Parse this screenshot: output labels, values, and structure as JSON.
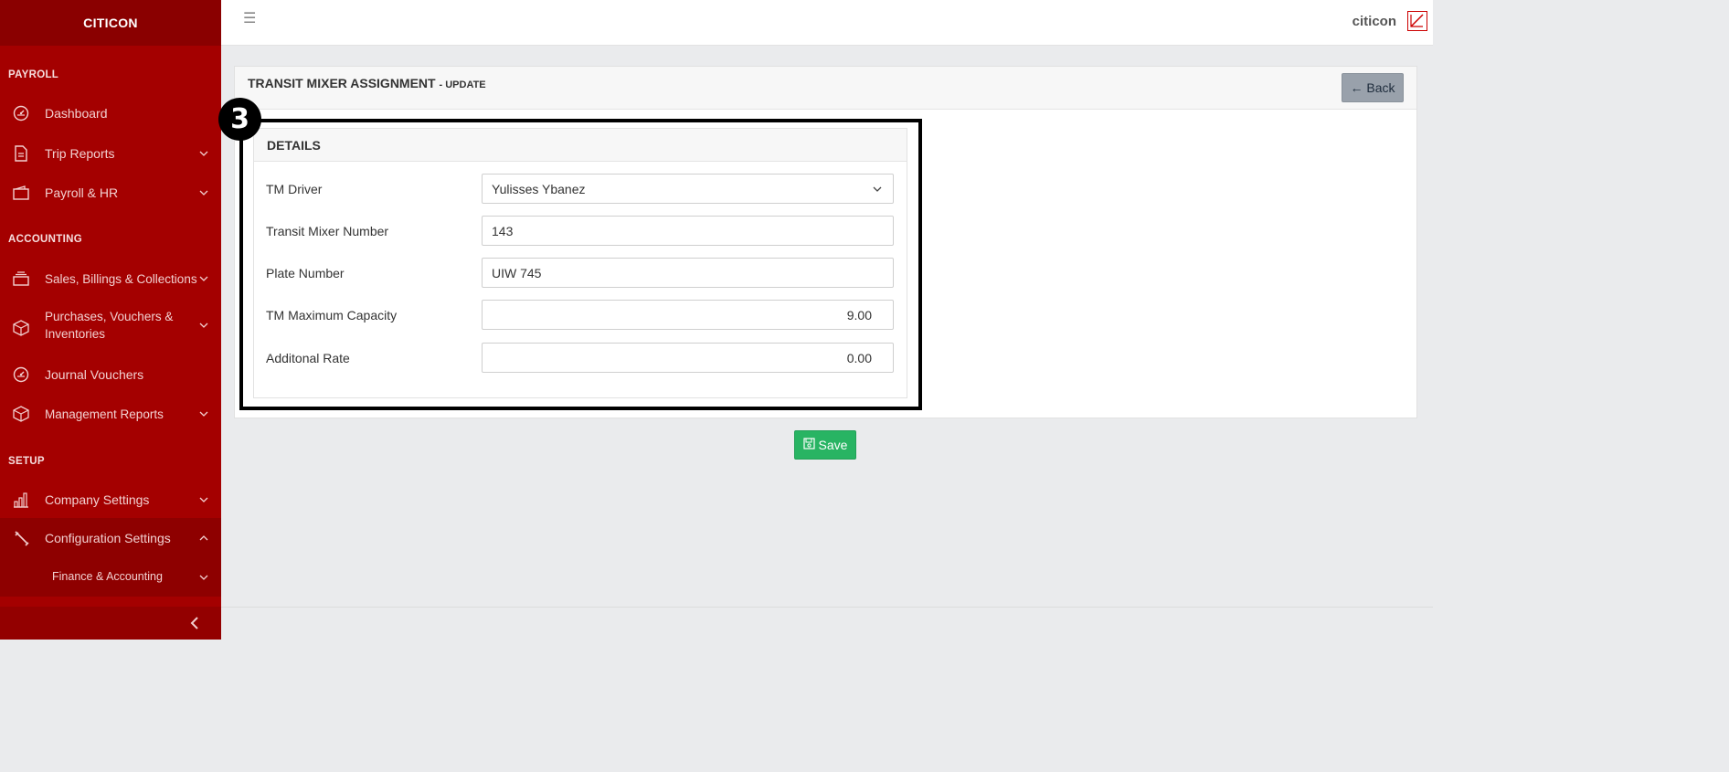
{
  "brand": "CITICON",
  "sidebar": {
    "sections": {
      "payroll": "PAYROLL",
      "accounting": "ACCOUNTING",
      "setup": "SETUP"
    },
    "items": {
      "dashboard": {
        "label": "Dashboard",
        "icon": "gauge-icon"
      },
      "trip_reports": {
        "label": "Trip Reports",
        "icon": "document-icon"
      },
      "payroll_hr": {
        "label": "Payroll & HR",
        "icon": "wallet-icon"
      },
      "sales": {
        "label": "Sales, Billings & Collections",
        "icon": "stack-icon"
      },
      "purchases": {
        "label_line1": "Purchases, Vouchers &",
        "label_line2": "Inventories",
        "icon": "box-icon"
      },
      "journal": {
        "label": "Journal Vouchers",
        "icon": "gauge-icon"
      },
      "mgmt_reports": {
        "label": "Management Reports",
        "icon": "box-icon"
      },
      "company_settings": {
        "label": "Company Settings",
        "icon": "building-chart-icon"
      },
      "config_settings": {
        "label": "Configuration Settings",
        "icon": "wrench-icon"
      },
      "finance_accounting": {
        "label": "Finance & Accounting"
      }
    }
  },
  "topbar": {
    "user_name": "citicon"
  },
  "page": {
    "title": "TRANSIT MIXER ASSIGNMENT",
    "subtitle": "- UPDATE",
    "back_label": "← Back",
    "step_badge": "3"
  },
  "details": {
    "title": "DETAILS",
    "fields": {
      "tm_driver": {
        "label": "TM Driver",
        "value": "Yulisses Ybanez"
      },
      "mixer_number": {
        "label": "Transit Mixer Number",
        "value": "143"
      },
      "plate_number": {
        "label": "Plate Number",
        "value": "UIW 745"
      },
      "max_capacity": {
        "label": "TM Maximum Capacity",
        "value": "9.00"
      },
      "additional_rate": {
        "label": "Additonal Rate",
        "value": "0.00"
      }
    }
  },
  "save_label": "Save",
  "colors": {
    "sidebar_bg": "#a40000",
    "brand_bg": "#8a0000",
    "save_green": "#28b463",
    "back_gray": "#99a1ab"
  }
}
